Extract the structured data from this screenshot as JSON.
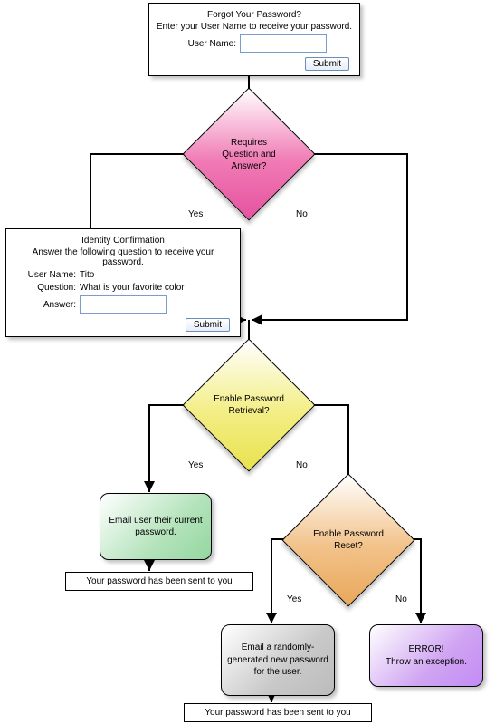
{
  "form1": {
    "title": "Forgot Your Password?",
    "sub": "Enter your User Name to receive your password.",
    "user_label": "User Name:",
    "user_value": "",
    "submit": "Submit"
  },
  "d1": {
    "text": "Requires Question and Answer?"
  },
  "edges": {
    "yes": "Yes",
    "no": "No"
  },
  "form2": {
    "title": "Identity Confirmation",
    "sub": "Answer the following question to receive your password.",
    "user_label": "User Name:",
    "user_value": "Tito",
    "q_label": "Question:",
    "q_value": "What is your favorite color",
    "a_label": "Answer:",
    "a_value": "",
    "submit": "Submit"
  },
  "d2": {
    "text": "Enable Password Retrieval?"
  },
  "a_green": {
    "text": "Email user their current password."
  },
  "msg1": {
    "text": "Your password has been sent to you"
  },
  "d3": {
    "text": "Enable Password Reset?"
  },
  "a_grey": {
    "text": "Email a randomly-generated new password for the user."
  },
  "a_purple": {
    "text": "ERROR!\nThrow an exception."
  },
  "msg2": {
    "text": "Your password has been sent to you"
  }
}
